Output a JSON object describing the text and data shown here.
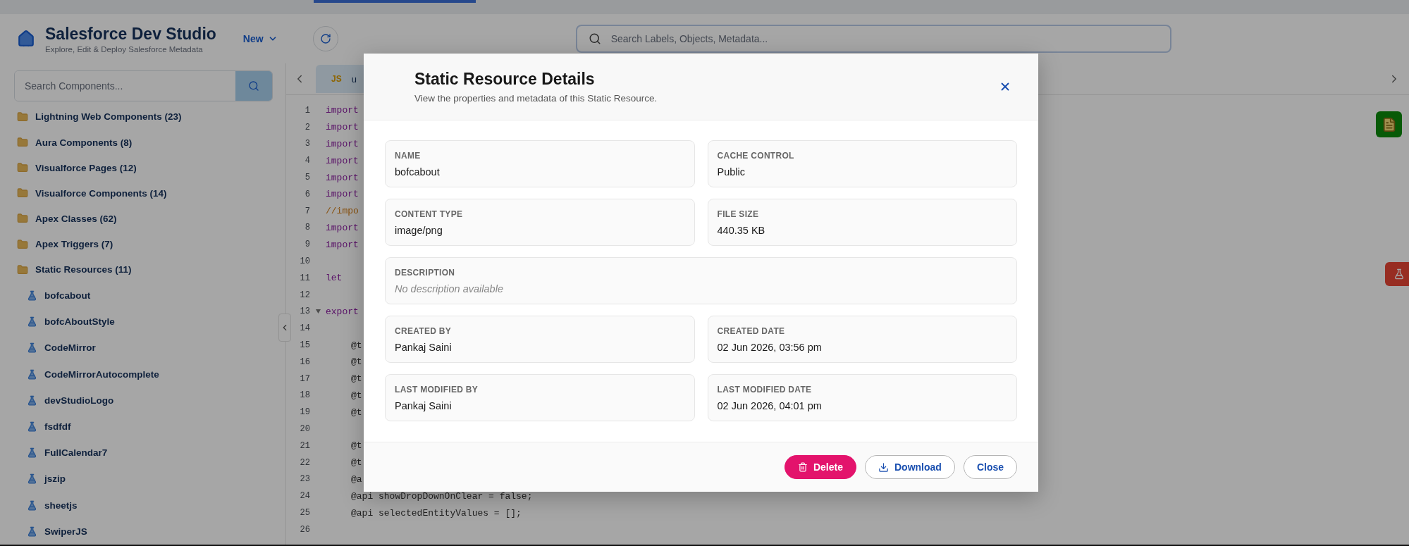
{
  "app": {
    "title": "Salesforce Dev Studio",
    "subtitle": "Explore, Edit & Deploy Salesforce Metadata",
    "new_menu": "New",
    "search": {
      "placeholder": "Search Labels, Objects, Metadata..."
    }
  },
  "sidebar": {
    "search": {
      "placeholder": "Search Components..."
    },
    "folders": [
      {
        "label": "Lightning Web Components (23)"
      },
      {
        "label": "Aura Components (8)"
      },
      {
        "label": "Visualforce Pages (12)"
      },
      {
        "label": "Visualforce Components (14)"
      },
      {
        "label": "Apex Classes (62)"
      },
      {
        "label": "Apex Triggers (7)"
      },
      {
        "label": "Static Resources (11)",
        "children": [
          {
            "label": "bofcabout"
          },
          {
            "label": "bofcAboutStyle"
          },
          {
            "label": "CodeMirror"
          },
          {
            "label": "CodeMirrorAutocomplete"
          },
          {
            "label": "devStudioLogo"
          },
          {
            "label": "fsdfdf"
          },
          {
            "label": "FullCalendar7"
          },
          {
            "label": "jszip"
          },
          {
            "label": "sheetjs"
          },
          {
            "label": "SwiperJS"
          }
        ]
      }
    ]
  },
  "editor": {
    "tab": {
      "badge": "JS",
      "label": "u"
    },
    "lines": [
      {
        "number": "1",
        "code": "import",
        "kind": "keyword",
        "foldable": false
      },
      {
        "number": "2",
        "code": "import",
        "kind": "keyword",
        "foldable": false
      },
      {
        "number": "3",
        "code": "import",
        "kind": "keyword",
        "foldable": false
      },
      {
        "number": "4",
        "code": "import",
        "kind": "keyword",
        "foldable": false
      },
      {
        "number": "5",
        "code": "import",
        "kind": "keyword",
        "foldable": false
      },
      {
        "number": "6",
        "code": "import",
        "kind": "keyword",
        "foldable": false
      },
      {
        "number": "7",
        "code": "//impo",
        "kind": "comment",
        "foldable": false
      },
      {
        "number": "8",
        "code": "import",
        "kind": "keyword",
        "foldable": false
      },
      {
        "number": "9",
        "code": "import",
        "kind": "keyword",
        "foldable": false
      },
      {
        "number": "10",
        "kind": "blank",
        "foldable": false
      },
      {
        "number": "11",
        "code": "let",
        "kind": "keyword",
        "foldable": false
      },
      {
        "number": "12",
        "kind": "blank",
        "foldable": false
      },
      {
        "number": "13",
        "code": "export",
        "kind": "keyword",
        "foldable": true
      },
      {
        "number": "14",
        "kind": "blank",
        "foldable": false
      },
      {
        "number": "15",
        "code": "@t",
        "kind": "indented",
        "foldable": false
      },
      {
        "number": "16",
        "code": "@t",
        "kind": "indented",
        "foldable": false
      },
      {
        "number": "17",
        "code": "@t",
        "kind": "indented",
        "foldable": false
      },
      {
        "number": "18",
        "code": "@t",
        "kind": "indented",
        "foldable": false
      },
      {
        "number": "19",
        "code": "@t",
        "kind": "indented",
        "foldable": false
      },
      {
        "number": "20",
        "kind": "blank",
        "foldable": false
      },
      {
        "number": "21",
        "code": "@t",
        "kind": "indented",
        "foldable": false
      },
      {
        "number": "22",
        "code": "@t",
        "kind": "indented",
        "foldable": false
      },
      {
        "number": "23",
        "code": "@a",
        "kind": "indented",
        "foldable": false
      },
      {
        "number": "24",
        "code": "@api showDropDownOnClear = false;",
        "kind": "indented",
        "foldable": false
      },
      {
        "number": "25",
        "code": "@api selectedEntityValues = [];",
        "kind": "indented",
        "foldable": false
      },
      {
        "number": "26",
        "kind": "blank",
        "foldable": false
      }
    ]
  },
  "modal": {
    "title": "Static Resource Details",
    "subtitle": "View the properties and metadata of this Static Resource.",
    "fields": [
      {
        "label": "NAME",
        "value": "bofcabout",
        "kind": "text",
        "wide": false
      },
      {
        "label": "CACHE CONTROL",
        "value": "Public",
        "kind": "text",
        "wide": false
      },
      {
        "label": "CONTENT TYPE",
        "value": "image/png",
        "kind": "text",
        "wide": false
      },
      {
        "label": "FILE SIZE",
        "value": "440.35 KB",
        "kind": "text",
        "wide": false
      },
      {
        "label": "DESCRIPTION",
        "value": "No description available",
        "kind": "empty",
        "wide": true
      },
      {
        "label": "CREATED BY",
        "value": "Pankaj Saini",
        "kind": "text",
        "wide": false
      },
      {
        "label": "CREATED DATE",
        "value": "02 Jun 2026, 03:56 pm",
        "kind": "text",
        "wide": false
      },
      {
        "label": "LAST MODIFIED BY",
        "value": "Pankaj Saini",
        "kind": "text",
        "wide": false
      },
      {
        "label": "LAST MODIFIED DATE",
        "value": "02 Jun 2026, 04:01 pm",
        "kind": "text",
        "wide": false
      }
    ],
    "buttons": [
      {
        "label": "Delete",
        "kind": "danger"
      },
      {
        "label": "Download",
        "kind": "download"
      },
      {
        "label": "Close",
        "kind": "plain"
      }
    ]
  }
}
